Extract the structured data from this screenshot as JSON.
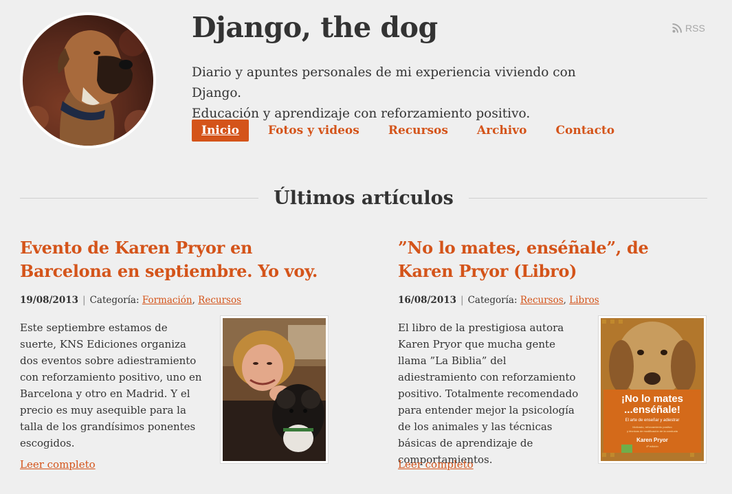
{
  "site": {
    "title": "Django, the dog",
    "tagline_line1": "Diario y apuntes personales de mi experiencia viviendo con Django.",
    "tagline_line2": "Educación y aprendizaje con reforzamiento positivo.",
    "rss_label": "RSS",
    "accent_color": "#d4541a"
  },
  "nav": {
    "items": [
      {
        "label": "Inicio",
        "active": true
      },
      {
        "label": "Fotos y videos"
      },
      {
        "label": "Recursos"
      },
      {
        "label": "Archivo"
      },
      {
        "label": "Contacto"
      }
    ]
  },
  "section": {
    "heading": "Últimos artículos"
  },
  "articles": [
    {
      "title": "Evento de Karen Pryor en Barcelona en septiembre. Yo voy.",
      "date": "19/08/2013",
      "category_label": "Categoría:",
      "categories": [
        "Formación",
        "Recursos"
      ],
      "excerpt": "Este septiembre estamos de suerte, KNS Ediciones organiza dos eventos sobre adiestramiento con reforzamiento positivo, uno en Barcelona y otro en Madrid. Y el precio es muy asequible para la talla de los grandísimos ponentes escogidos.",
      "read_more": "Leer completo"
    },
    {
      "title": "”No lo mates, enséñale”, de Karen Pryor (Libro)",
      "date": "16/08/2013",
      "category_label": "Categoría:",
      "categories": [
        "Recursos",
        "Libros"
      ],
      "excerpt": "El libro de la prestigiosa autora Karen Pryor que mucha gente llama ”La Biblia” del adiestramiento con reforzamiento positivo. Totalmente recomendado para entender mejor la psicología de los animales y las técnicas básicas de aprendizaje de comportamientos.",
      "read_more": "Leer completo",
      "cover": {
        "title_line1": "¡No lo mates",
        "title_line2": "...enséñale!",
        "subtitle": "El arte de enseñar y adiestrar",
        "fine_print_line1": "Motivado, reforzamiento positivo",
        "fine_print_line2": "y técnicas de modificación de la conducta",
        "author": "Karen Pryor",
        "edition": "4ª edición"
      }
    }
  ]
}
